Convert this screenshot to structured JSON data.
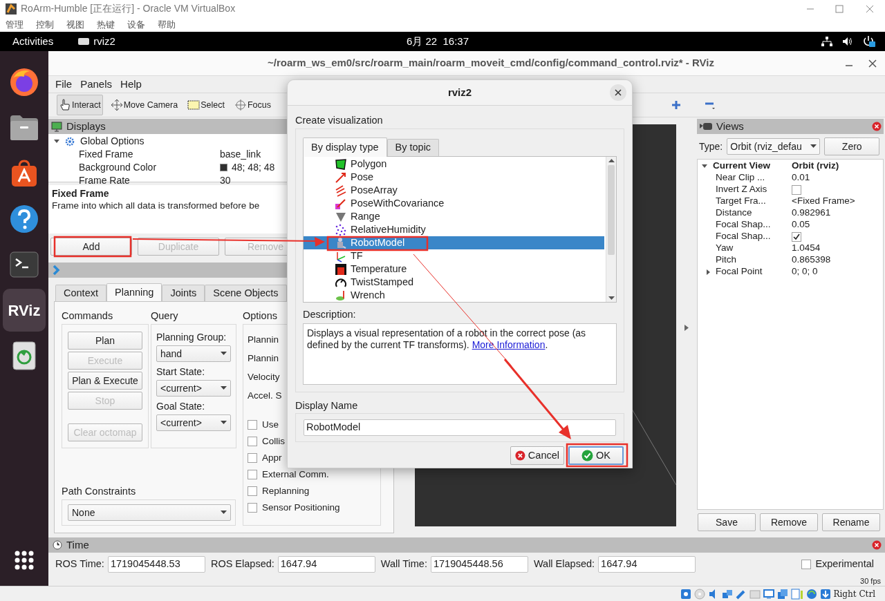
{
  "vbox": {
    "title": "RoArm-Humble [正在运行] - Oracle VM VirtualBox",
    "menu": [
      "管理",
      "控制",
      "视图",
      "热键",
      "设备",
      "帮助"
    ],
    "host_key": "Right Ctrl"
  },
  "topbar": {
    "activities": "Activities",
    "app": "rviz2",
    "clock": "6月 22  16:37"
  },
  "dock": [
    {
      "kind": "firefox",
      "selected": false
    },
    {
      "kind": "files",
      "selected": false
    },
    {
      "kind": "store",
      "selected": false
    },
    {
      "kind": "help",
      "selected": false
    },
    {
      "kind": "terminal",
      "selected": false
    },
    {
      "kind": "rviz",
      "selected": true,
      "label": "RViz"
    },
    {
      "kind": "trash",
      "selected": false
    }
  ],
  "rviz": {
    "title": "~/roarm_ws_em0/src/roarm_main/roarm_moveit_cmd/config/command_control.rviz* - RViz",
    "menu": [
      "File",
      "Panels",
      "Help"
    ],
    "tools": [
      {
        "kind": "interact",
        "label": "Interact",
        "selected": true
      },
      {
        "kind": "move",
        "label": "Move Camera",
        "selected": false
      },
      {
        "kind": "select",
        "label": "Select",
        "selected": false
      },
      {
        "kind": "focus",
        "label": "Focus",
        "selected": false
      }
    ]
  },
  "displays": {
    "title": "Displays",
    "tree": [
      {
        "label": "Global Options",
        "expanded": true,
        "children": [
          {
            "label": "Fixed Frame",
            "value": "base_link"
          },
          {
            "label": "Background Color",
            "value": "48; 48; 48",
            "color": "#303030"
          },
          {
            "label": "Frame Rate",
            "value": "30"
          }
        ]
      }
    ],
    "help_title": "Fixed Frame",
    "help_text": "Frame into which all data is transformed before be",
    "buttons": [
      {
        "label": "Add",
        "disabled": false
      },
      {
        "label": "Duplicate",
        "disabled": true
      },
      {
        "label": "Remove",
        "disabled": true
      }
    ]
  },
  "planning": {
    "tabs": [
      {
        "label": "Context",
        "selected": false
      },
      {
        "label": "Planning",
        "selected": true
      },
      {
        "label": "Joints",
        "selected": false
      },
      {
        "label": "Scene Objects",
        "selected": false
      }
    ],
    "commands_title": "Commands",
    "commands": [
      {
        "label": "Plan",
        "disabled": false
      },
      {
        "label": "Execute",
        "disabled": true
      },
      {
        "label": "Plan & Execute",
        "disabled": false
      },
      {
        "label": "Stop",
        "disabled": true
      },
      {
        "label": "Clear octomap",
        "disabled": true
      }
    ],
    "query_title": "Query",
    "query": [
      {
        "label": "Planning Group:",
        "value": "hand"
      },
      {
        "label": "Start State:",
        "value": "<current>"
      },
      {
        "label": "Goal State:",
        "value": "<current>"
      }
    ],
    "options_title": "Options",
    "options_labels": [
      "Plannin",
      "Plannin",
      "Velocity",
      "Accel. S"
    ],
    "options_checks": [
      {
        "label": "Use",
        "checked": false
      },
      {
        "label": "Collis",
        "checked": false
      },
      {
        "label": "Appr",
        "checked": false
      },
      {
        "label": "External Comm.",
        "checked": false
      },
      {
        "label": "Replanning",
        "checked": false
      },
      {
        "label": "Sensor Positioning",
        "checked": false
      }
    ],
    "path_title": "Path Constraints",
    "path_value": "None"
  },
  "views": {
    "title": "Views",
    "type_label": "Type:",
    "type_value": "Orbit (rviz_defau",
    "zero": "Zero",
    "tree": [
      {
        "label": "Current View",
        "value": "Orbit (rviz)",
        "expanded": true,
        "children": [
          {
            "label": "Near Clip ...",
            "value": "0.01"
          },
          {
            "label": "Invert Z Axis",
            "kind": "check",
            "checked": false
          },
          {
            "label": "Target Fra...",
            "value": "<Fixed Frame>"
          },
          {
            "label": "Distance",
            "value": "0.982961"
          },
          {
            "label": "Focal Shap...",
            "value": "0.05"
          },
          {
            "label": "Focal Shap...",
            "kind": "check",
            "checked": true
          },
          {
            "label": "Yaw",
            "value": "1.0454"
          },
          {
            "label": "Pitch",
            "value": "0.865398"
          },
          {
            "label": "Focal Point",
            "value": "0; 0; 0",
            "expanded": false
          }
        ]
      }
    ],
    "buttons": [
      "Save",
      "Remove",
      "Rename"
    ]
  },
  "time": {
    "title": "Time",
    "fields": [
      {
        "label": "ROS Time:",
        "value": "1719045448.53"
      },
      {
        "label": "ROS Elapsed:",
        "value": "1647.94"
      },
      {
        "label": "Wall Time:",
        "value": "1719045448.56"
      },
      {
        "label": "Wall Elapsed:",
        "value": "1647.94"
      }
    ],
    "experimental": {
      "label": "Experimental",
      "checked": false
    },
    "fps": "30 fps"
  },
  "dialog": {
    "title": "rviz2",
    "heading": "Create visualization",
    "tabs": [
      {
        "label": "By display type",
        "selected": true
      },
      {
        "label": "By topic",
        "selected": false
      }
    ],
    "items": [
      {
        "kind": "polygon",
        "label": "Polygon",
        "selected": false
      },
      {
        "kind": "pose",
        "label": "Pose",
        "selected": false
      },
      {
        "kind": "posearray",
        "label": "PoseArray",
        "selected": false
      },
      {
        "kind": "posecov",
        "label": "PoseWithCovariance",
        "selected": false
      },
      {
        "kind": "range",
        "label": "Range",
        "selected": false
      },
      {
        "kind": "humidity",
        "label": "RelativeHumidity",
        "selected": false
      },
      {
        "kind": "robot",
        "label": "RobotModel",
        "selected": true
      },
      {
        "kind": "tf",
        "label": "TF",
        "selected": false
      },
      {
        "kind": "temperature",
        "label": "Temperature",
        "selected": false
      },
      {
        "kind": "twist",
        "label": "TwistStamped",
        "selected": false
      },
      {
        "kind": "wrench",
        "label": "Wrench",
        "selected": false
      }
    ],
    "description_label": "Description:",
    "description": "Displays a visual representation of a robot in the correct pose (as defined by the current TF transforms).",
    "link": "More Information",
    "description_end": ".",
    "name_label": "Display Name",
    "name_value": "RobotModel",
    "buttons": [
      {
        "kind": "cancel",
        "label": "Cancel",
        "default": false
      },
      {
        "kind": "ok",
        "label": "OK",
        "default": true
      }
    ]
  }
}
